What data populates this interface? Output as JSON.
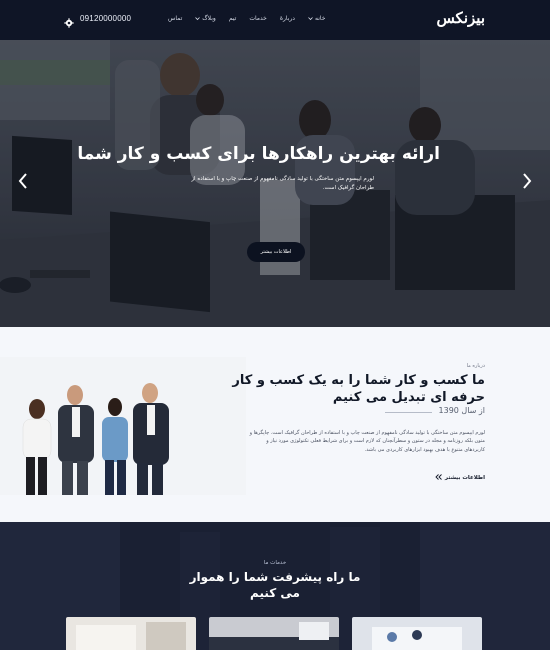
{
  "header": {
    "logo": "بیزنکس",
    "phone": "09120000000",
    "nav": [
      {
        "label": "خانه",
        "has_dropdown": true
      },
      {
        "label": "دربارۀ",
        "has_dropdown": false
      },
      {
        "label": "خدمات",
        "has_dropdown": false
      },
      {
        "label": "تیم",
        "has_dropdown": false
      },
      {
        "label": "وبلاگ",
        "has_dropdown": true
      },
      {
        "label": "تماس",
        "has_dropdown": false
      }
    ]
  },
  "hero": {
    "title": "ارائه بهترین راهکارها برای کسب و کار شما",
    "description": "لورم ایپسوم متن ساختگی با تولید سادگی نامفهوم از صنعت چاپ و با استفاده از طراحان گرافیک است.",
    "button_label": "اطلاعات بیشتر"
  },
  "about": {
    "kicker": "درباره ما",
    "title": "ما کسب و کار شما را به یک کسب و کار حرفه ای تبدیل می کنیم",
    "since": "از سال 1390",
    "text": "لورم ایپسوم متن ساختگی با تولید سادگی نامفهوم از صنعت چاپ و با استفاده از طراحان گرافیک است. چاپگرها و متون بلکه روزنامه و مجله در ستون و سطرآنچنان که لازم است و برای شرایط فعلی تکنولوژی مورد نیاز و کاربردهای متنوع با هدف بهبود ابزارهای کاربردی می باشد.",
    "link_label": "اطلاعات بیشتر"
  },
  "services": {
    "kicker": "خدمات ما",
    "title": "ما راه پیشرفت شما را هموار می کنیم"
  },
  "colors": {
    "header_bg": "#0f1526",
    "services_bg": "#1a2033",
    "about_bg": "#f5f7fb"
  }
}
